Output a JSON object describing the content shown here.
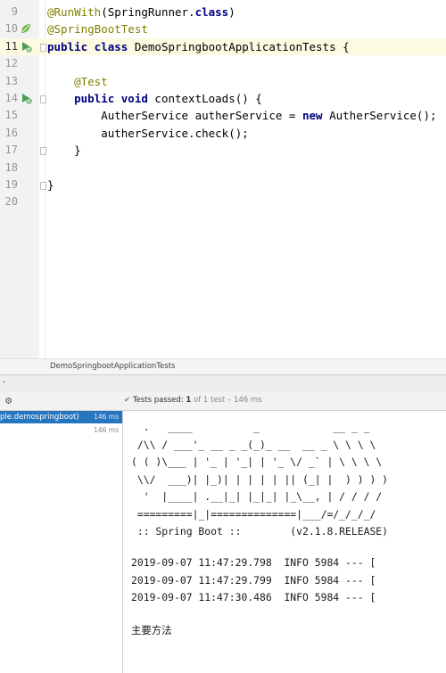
{
  "editor": {
    "lines": [
      {
        "no": "9",
        "icon": "",
        "segments": [
          {
            "t": "@RunWith",
            "c": "ann"
          },
          {
            "t": "(SpringRunner.",
            "c": ""
          },
          {
            "t": "class",
            "c": "kw"
          },
          {
            "t": ")",
            "c": ""
          }
        ]
      },
      {
        "no": "10",
        "icon": "spring-bean-icon",
        "segments": [
          {
            "t": "@SpringBootTest",
            "c": "ann"
          }
        ]
      },
      {
        "no": "11",
        "icon": "run-test-icon",
        "segments": [
          {
            "t": "public class ",
            "c": "kw"
          },
          {
            "t": "DemoSpringbootApplicationTests",
            "c": "cls"
          },
          {
            "t": " {",
            "c": ""
          }
        ]
      },
      {
        "no": "12",
        "icon": "",
        "segments": []
      },
      {
        "no": "13",
        "icon": "",
        "segments": [
          {
            "t": "    @Test",
            "c": "ann"
          }
        ]
      },
      {
        "no": "14",
        "icon": "run-test-icon",
        "segments": [
          {
            "t": "    public void ",
            "c": "kw"
          },
          {
            "t": "contextLoads() {",
            "c": ""
          }
        ]
      },
      {
        "no": "15",
        "icon": "",
        "segments": [
          {
            "t": "        AutherService autherService = ",
            "c": ""
          },
          {
            "t": "new ",
            "c": "kw"
          },
          {
            "t": "AutherService();",
            "c": ""
          }
        ]
      },
      {
        "no": "16",
        "icon": "",
        "segments": [
          {
            "t": "        autherService.check();",
            "c": ""
          }
        ]
      },
      {
        "no": "17",
        "icon": "",
        "segments": [
          {
            "t": "    }",
            "c": ""
          }
        ]
      },
      {
        "no": "18",
        "icon": "",
        "segments": []
      },
      {
        "no": "19",
        "icon": "",
        "segments": [
          {
            "t": "}",
            "c": ""
          }
        ]
      },
      {
        "no": "20",
        "icon": "",
        "segments": []
      }
    ],
    "current_line": "11",
    "breadcrumb": "DemoSpringbootApplicationTests"
  },
  "test_run": {
    "status_prefix": "Tests passed:",
    "passed": "1",
    "of_total": "of 1 test",
    "duration": "– 146 ms",
    "tree": [
      {
        "label": "ple.demospringboot)",
        "time": "146 ms",
        "selected": true
      },
      {
        "label": "",
        "time": "146 ms",
        "selected": false
      }
    ]
  },
  "console": {
    "lines": [
      "  .   ____          _            __ _ _",
      " /\\\\ / ___'_ __ _ _(_)_ __  __ _ \\ \\ \\ \\",
      "( ( )\\___ | '_ | '_| | '_ \\/ _` | \\ \\ \\ \\",
      " \\\\/  ___)| |_)| | | | | || (_| |  ) ) ) )",
      "  '  |____| .__|_| |_|_| |_\\__, | / / / /",
      " =========|_|==============|___/=/_/_/_/",
      " :: Spring Boot ::        (v2.1.8.RELEASE)",
      "",
      "2019-09-07 11:47:29.798  INFO 5984 --- [",
      "2019-09-07 11:47:29.799  INFO 5984 --- [",
      "2019-09-07 11:47:30.486  INFO 5984 --- [",
      "",
      "主要方法"
    ]
  },
  "colors": {
    "accent": "#2675bf",
    "pass": "#499c54",
    "keyword": "#000080",
    "annotation": "#808000"
  }
}
